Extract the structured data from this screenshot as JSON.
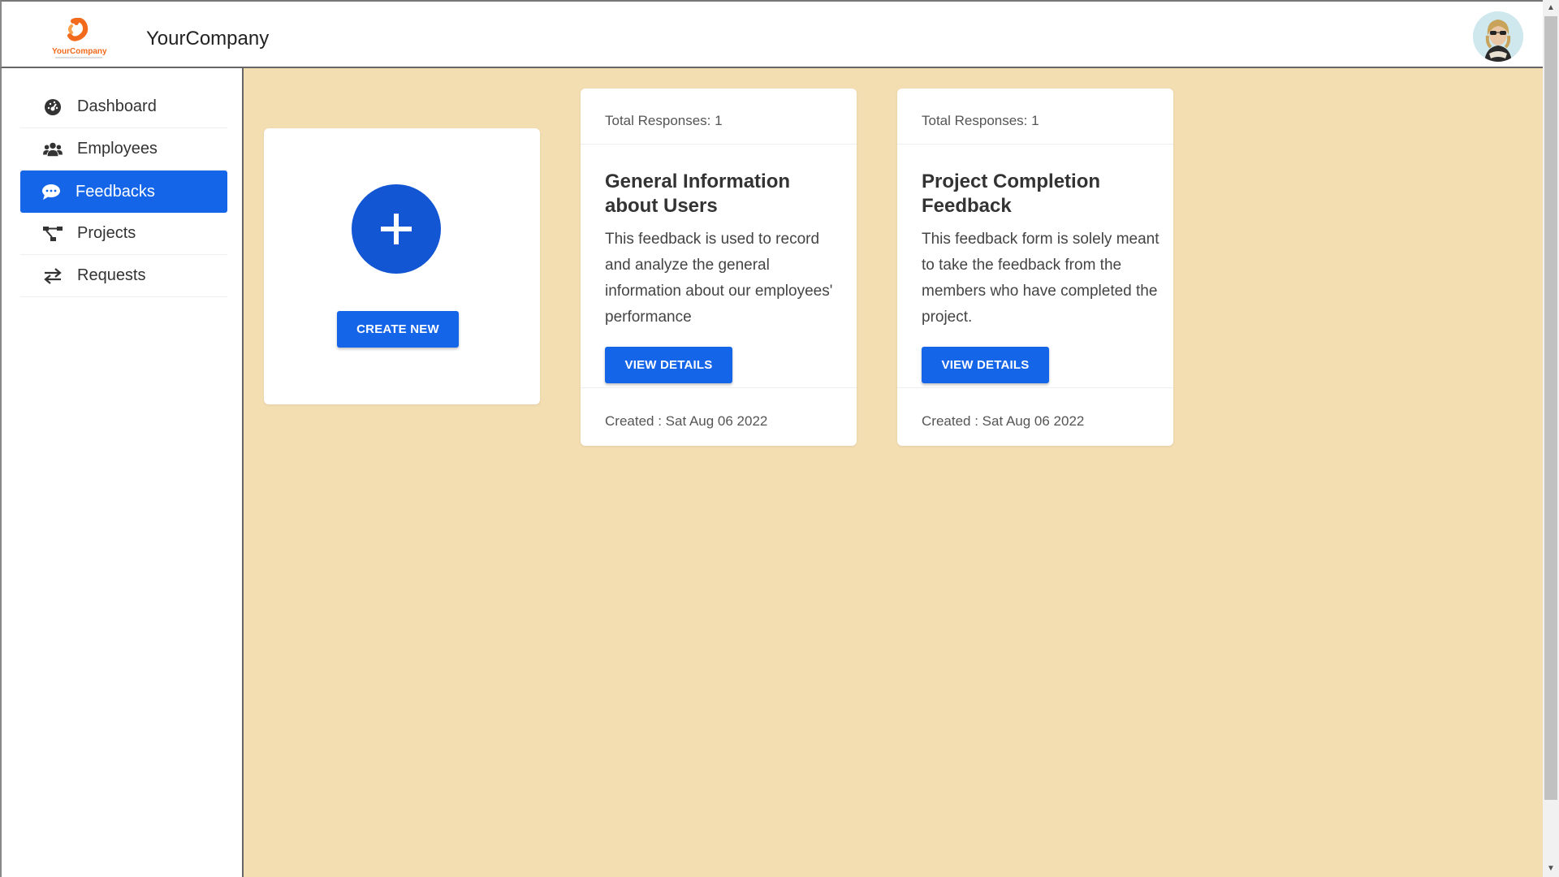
{
  "header": {
    "logo_text": "YourCompany",
    "brand": "YourCompany"
  },
  "sidebar": {
    "items": [
      {
        "label": "Dashboard",
        "icon": "dashboard-icon"
      },
      {
        "label": "Employees",
        "icon": "users-icon"
      },
      {
        "label": "Feedbacks",
        "icon": "chat-bubble-icon",
        "active": true
      },
      {
        "label": "Projects",
        "icon": "project-diagram-icon"
      },
      {
        "label": "Requests",
        "icon": "exchange-arrows-icon"
      }
    ]
  },
  "main": {
    "create_card": {
      "button_label": "CREATE NEW"
    },
    "feedback_cards": [
      {
        "responses": "Total Responses: 1",
        "title": "General Information about Users",
        "description": "This feedback is used to record and analyze the general information about our employees' performance",
        "button_label": "VIEW DETAILS",
        "created": "Created : Sat Aug 06 2022"
      },
      {
        "responses": "Total Responses: 1",
        "title": "Project Completion Feedback",
        "description": "This feedback form is solely meant to take the feedback from the members who have completed the project.",
        "button_label": "VIEW DETAILS",
        "created": "Created : Sat Aug 06 2022"
      }
    ]
  },
  "colors": {
    "accent": "#1565e8",
    "plus_circle": "#1356d4",
    "background": "#f3deb2",
    "logo_orange": "#f26a1b"
  }
}
